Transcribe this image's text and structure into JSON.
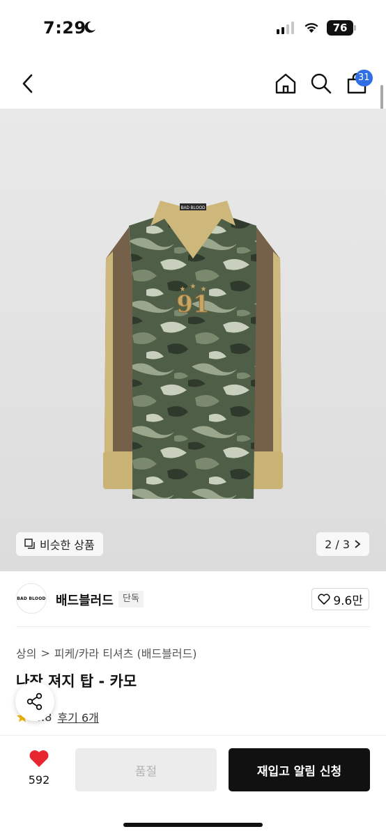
{
  "status_bar": {
    "time": "7:29",
    "battery": "76"
  },
  "nav": {
    "cart_count": "31"
  },
  "product_image": {
    "brand_tag": "BAD BLOOD",
    "jersey_number": "91",
    "similar_label": "비슷한 상품",
    "counter": "2 / 3"
  },
  "brand": {
    "logo_text": "BAD BLOOD",
    "name": "배드블러드",
    "badge": "단독",
    "likes": "9.6만"
  },
  "breadcrumb": {
    "category": "상의",
    "separator": ">",
    "subcategory": "피케/카라 티셔츠 (배드블러드)"
  },
  "product": {
    "title": "나잔 져지 탑 - 카모",
    "rating": "4.8",
    "reviews": "후기 6개"
  },
  "bottom_bar": {
    "wish_count": "592",
    "soldout_label": "품절",
    "restock_label": "재입고 알림 신청"
  },
  "colors": {
    "accent_blue": "#2f6fe4",
    "heart_red": "#e8262f",
    "star_yellow": "#f5b90a"
  }
}
